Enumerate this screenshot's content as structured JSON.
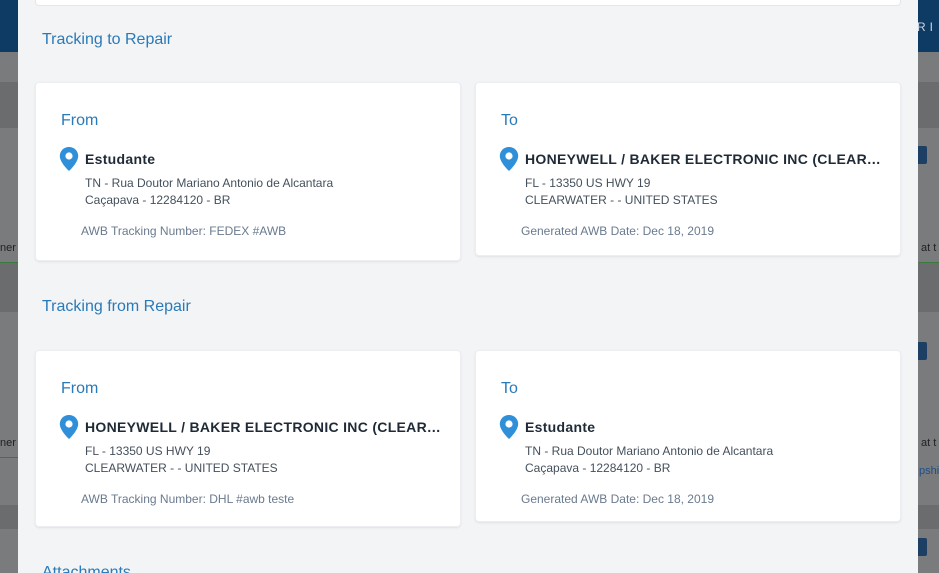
{
  "background": {
    "left_labels": [
      "ner",
      "ner"
    ],
    "right_labels": [
      "at t",
      "at t"
    ],
    "right_link": "pshi",
    "topright_text": "RI"
  },
  "tracking_to_repair": {
    "title": "Tracking to Repair",
    "from": {
      "label": "From",
      "name": "Estudante",
      "address_line1": "TN - Rua Doutor Mariano Antonio de Alcantara",
      "address_line2": "Caçapava - 12284120 - BR",
      "meta": "AWB Tracking Number: FEDEX #AWB"
    },
    "to": {
      "label": "To",
      "name": "HONEYWELL / BAKER ELECTRONIC INC (CLEARWATER)",
      "address_line1": "FL - 13350 US HWY 19",
      "address_line2": "CLEARWATER - - UNITED STATES",
      "meta": "Generated AWB Date: Dec 18, 2019"
    }
  },
  "tracking_from_repair": {
    "title": "Tracking from Repair",
    "from": {
      "label": "From",
      "name": "HONEYWELL / BAKER ELECTRONIC INC (CLEARWATER)",
      "address_line1": "FL - 13350 US HWY 19",
      "address_line2": "CLEARWATER - - UNITED STATES",
      "meta": "AWB Tracking Number: DHL #awb teste"
    },
    "to": {
      "label": "To",
      "name": "Estudante",
      "address_line1": "TN - Rua Doutor Mariano Antonio de Alcantara",
      "address_line2": "Caçapava - 12284120 - BR",
      "meta": "Generated AWB Date: Dec 18, 2019"
    }
  },
  "attachments": {
    "title": "Attachments"
  },
  "colors": {
    "accent": "#2a7ab8",
    "pin": "#2f8fd8",
    "modal_bg": "#f3f4f6"
  },
  "icons": {
    "location": "map-pin-icon"
  }
}
